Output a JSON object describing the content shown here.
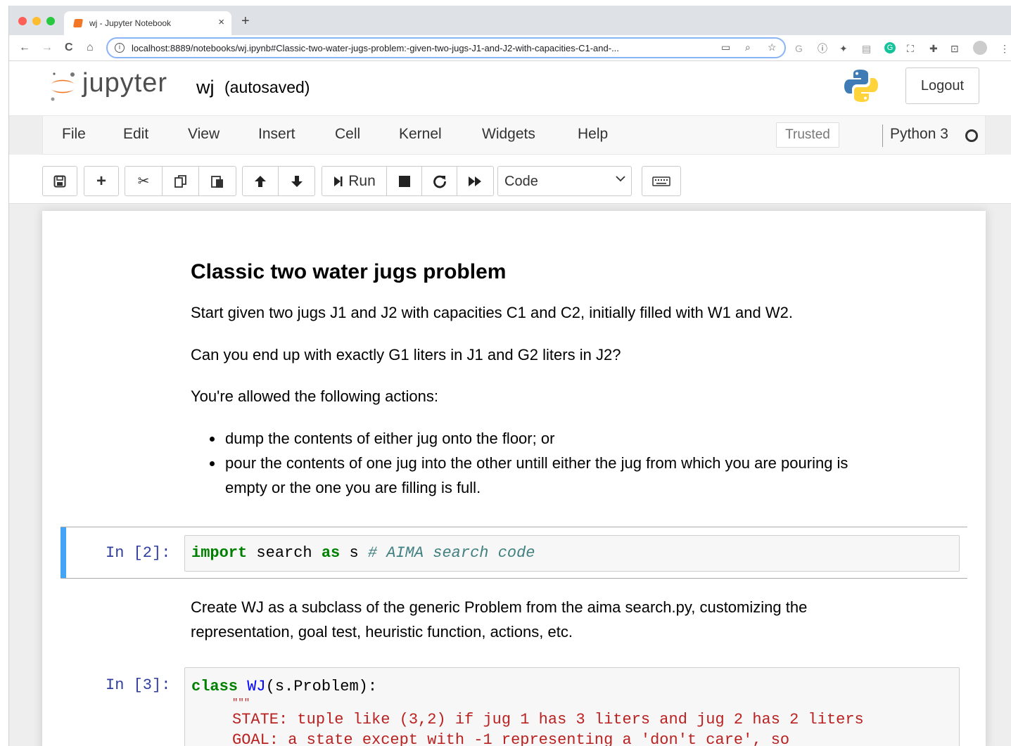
{
  "browser": {
    "tab_title": "wj - Jupyter Notebook",
    "tab_close": "×",
    "new_tab": "+",
    "url": "localhost:8889/notebooks/wj.ipynb#Classic-two-water-jugs-problem:-given-two-jugs-J1-and-J2-with-capacities-C1-and-...",
    "back": "←",
    "forward": "→",
    "reload": "C",
    "home": "⌂"
  },
  "header": {
    "logo_text": "jupyter",
    "notebook_name": "wj",
    "save_status": "(autosaved)",
    "logout_label": "Logout"
  },
  "menubar": {
    "items": [
      "File",
      "Edit",
      "View",
      "Insert",
      "Cell",
      "Kernel",
      "Widgets",
      "Help"
    ],
    "trusted_label": "Trusted",
    "kernel_name": "Python 3"
  },
  "toolbar": {
    "run_label": "Run",
    "cell_type": "Code"
  },
  "notebook": {
    "heading": "Classic two water jugs problem",
    "para1": "Start given two jugs J1 and J2 with capacities C1 and C2, initially filled with W1 and W2.",
    "para2": "Can you end up with exactly G1 liters in J1 and G2 liters in J2?",
    "para3": "You're allowed the following actions:",
    "bullet1": "dump the contents of either jug onto the floor; or",
    "bullet2_line1": "pour the contents of one jug into the other untill either the jug from which you are pouring is",
    "bullet2_line2": "empty or the one you are filling is full.",
    "cell2": {
      "prompt": "In [2]:",
      "kw_import": "import",
      "module": " search ",
      "kw_as": "as",
      "alias": " s ",
      "comment": "# AIMA search code"
    },
    "para4_line1": "Create WJ as a subclass of the generic Problem from the aima search.py, customizing the",
    "para4_line2": "representation, goal test, heuristic function, actions, etc.",
    "cell3": {
      "prompt": "In [3]:",
      "kw_class": "class",
      "class_name": "WJ",
      "class_rest": "(s.Problem):",
      "docstring_open": "\"\"\"",
      "doc_line1": "STATE: tuple like (3,2) if jug 1 has 3 liters and jug 2 has 2 liters",
      "doc_line2": "GOAL: a state except with -1 representing a 'don't care', so"
    }
  }
}
